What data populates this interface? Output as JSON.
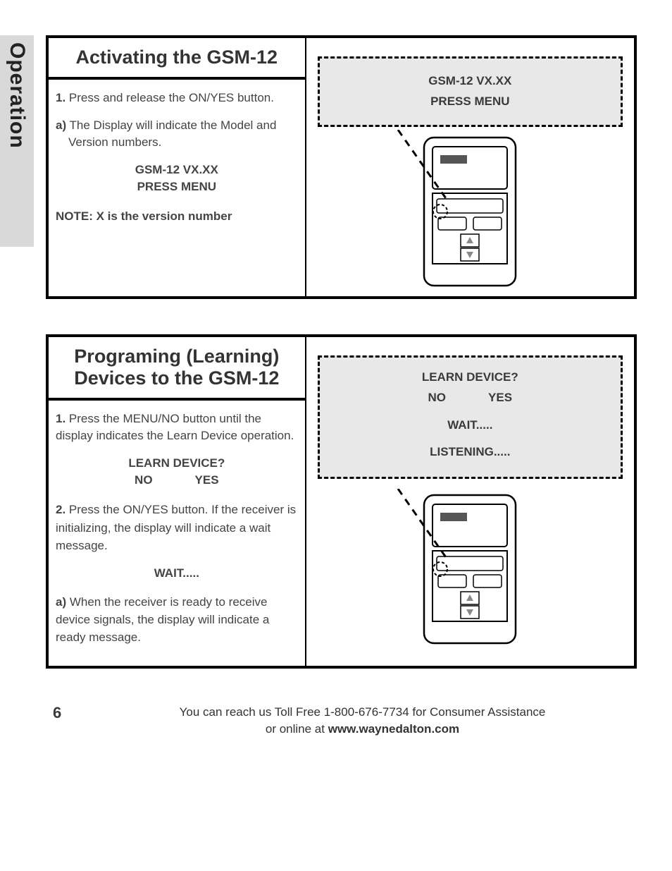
{
  "sideTab": "Operation",
  "section1": {
    "title": "Activating the GSM-12",
    "step1_num": "1.",
    "step1_text": " Press and release the ON/YES button.",
    "sub_a_lbl": "a)",
    "sub_a_text": " The Display will indicate the Model and",
    "sub_a_text2": "Version numbers.",
    "disp_line1": "GSM-12 VX.XX",
    "disp_line2": "PRESS MENU",
    "note": "NOTE: X is the version number",
    "callout_line1": "GSM-12 VX.XX",
    "callout_line2": "PRESS MENU"
  },
  "section2": {
    "title_l1": "Programing (Learning)",
    "title_l2": "Devices to the GSM-12",
    "step1_num": "1.",
    "step1_text": " Press the MENU/NO button until the display indicates the Learn Device operation.",
    "disp1_line1": "LEARN DEVICE?",
    "disp1_no": "NO",
    "disp1_yes": "YES",
    "step2_num": "2.",
    "step2_text": " Press the ON/YES button. If the receiver is",
    "step2_text2": "initializing, the display will indicate a wait message.",
    "disp2": "WAIT.....",
    "sub_a_lbl": "a)",
    "sub_a_text": " When the receiver is ready to receive device signals, the display will indicate a ready message.",
    "callout_line1": "LEARN DEVICE?",
    "callout_no": "NO",
    "callout_yes": "YES",
    "callout_line3": "WAIT.....",
    "callout_line4": "LISTENING....."
  },
  "footer": {
    "pageNum": "6",
    "line1": "You can reach us Toll Free 1-800-676-7734 for Consumer Assistance",
    "line2_pre": "or online at ",
    "url": "www.waynedalton.com"
  }
}
